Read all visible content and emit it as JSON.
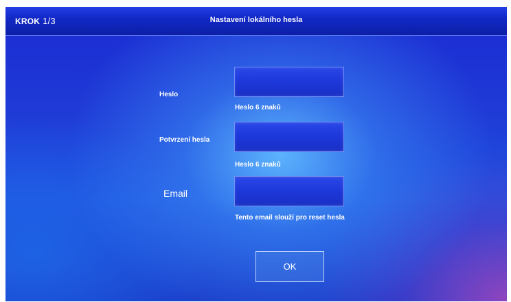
{
  "header": {
    "step_label": "KROK",
    "step_value": "1/3",
    "title": "Nastavení lokálního hesla"
  },
  "form": {
    "password": {
      "label": "Heslo",
      "value": "",
      "hint": "Heslo 6 znaků"
    },
    "confirm_password": {
      "label": "Potvrzení hesla",
      "value": "",
      "hint": "Heslo 6 znaků"
    },
    "email": {
      "label": "Email",
      "value": "",
      "hint": "Tento email slouží pro reset hesla"
    },
    "ok_label": "OK"
  },
  "colors": {
    "background": "#1f3ad6",
    "title_bar": "#1228c6",
    "field_fill": "#1c36d8",
    "text": "#ffffff"
  }
}
